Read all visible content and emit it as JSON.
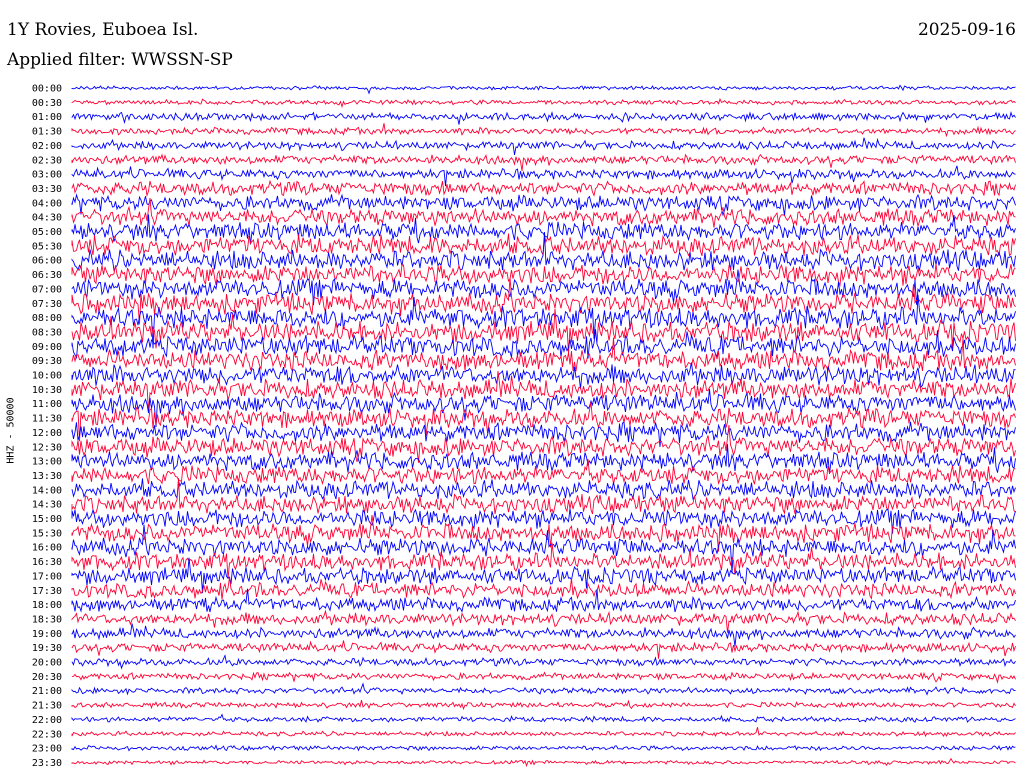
{
  "header": {
    "station": "1Y Rovies, Euboea Isl.",
    "date": "2025-09-16",
    "filter": "Applied filter: WWSSN-SP"
  },
  "chart_data": {
    "type": "line",
    "title": "1Y Rovies, Euboea Isl.",
    "subtitle": "Applied filter: WWSSN-SP",
    "date": "2025-09-16",
    "ylabel": "HHZ - 50000",
    "row_labels": [
      "00:00",
      "00:30",
      "01:00",
      "01:30",
      "02:00",
      "02:30",
      "03:00",
      "03:30",
      "04:00",
      "04:30",
      "05:00",
      "05:30",
      "06:00",
      "06:30",
      "07:00",
      "07:30",
      "08:00",
      "08:30",
      "09:00",
      "09:30",
      "10:00",
      "10:30",
      "11:00",
      "11:30",
      "12:00",
      "12:30",
      "13:00",
      "13:30",
      "14:00",
      "14:30",
      "15:00",
      "15:30",
      "16:00",
      "16:30",
      "17:00",
      "17:30",
      "18:00",
      "18:30",
      "19:00",
      "19:30",
      "20:00",
      "20:30",
      "21:00",
      "21:30",
      "22:00",
      "22:30",
      "23:00",
      "23:30"
    ],
    "series_colors": [
      "#0000ff",
      "#ff0033"
    ],
    "amplitude_per_row": [
      0.25,
      0.3,
      0.5,
      0.45,
      0.55,
      0.6,
      0.65,
      0.9,
      1.0,
      1.1,
      1.2,
      1.3,
      1.3,
      1.3,
      1.3,
      1.35,
      1.4,
      1.4,
      1.35,
      1.3,
      1.3,
      1.3,
      1.25,
      1.25,
      1.25,
      1.25,
      1.2,
      1.2,
      1.2,
      1.2,
      1.2,
      1.2,
      1.2,
      1.15,
      1.1,
      1.0,
      0.9,
      0.8,
      0.7,
      0.6,
      0.5,
      0.45,
      0.4,
      0.35,
      0.35,
      0.3,
      0.3,
      0.25
    ],
    "grid": false
  }
}
